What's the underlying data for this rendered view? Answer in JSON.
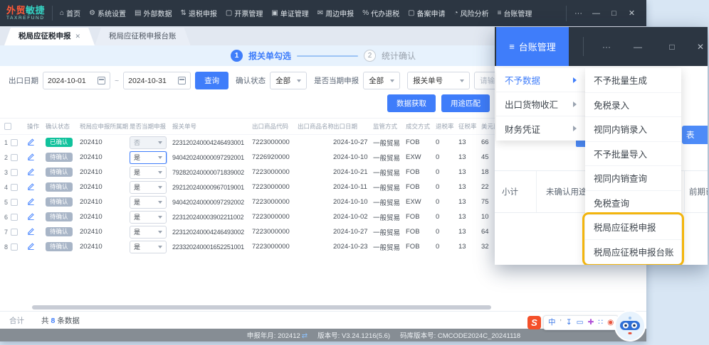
{
  "navbar": {
    "items": [
      {
        "id": "home",
        "glyph": "⌂",
        "icon": "home-icon",
        "label": "首页"
      },
      {
        "id": "system-settings",
        "glyph": "⚙",
        "icon": "gear-icon",
        "label": "系统设置"
      },
      {
        "id": "external-data",
        "glyph": "▤",
        "icon": "list-icon",
        "label": "外部数据"
      },
      {
        "id": "tax-refund-declare",
        "glyph": "⇅",
        "icon": "exchange-icon",
        "label": "退税申报"
      },
      {
        "id": "invoice-mgmt",
        "glyph": "▢",
        "icon": "document-icon",
        "label": "开票管理"
      },
      {
        "id": "document-mgmt",
        "glyph": "▣",
        "icon": "file-icon",
        "label": "单证管理"
      },
      {
        "id": "peripheral-declare",
        "glyph": "✉",
        "icon": "mail-icon",
        "label": "周边申报"
      },
      {
        "id": "agency-refund",
        "glyph": "%",
        "icon": "percent-icon",
        "label": "代办退税"
      },
      {
        "id": "filing-apply",
        "glyph": "▢",
        "icon": "document-icon",
        "label": "备案申请"
      },
      {
        "id": "risk-analysis",
        "glyph": "◔",
        "icon": "clock-icon",
        "label": "风险分析"
      },
      {
        "id": "ledger-mgmt",
        "glyph": "≡",
        "icon": "ledger-icon",
        "label": "台账管理"
      }
    ],
    "logo": {
      "part1": "外贸",
      "part2": "敏捷",
      "subtitle": "TAXREFUND"
    },
    "controls": {
      "more": "···",
      "minimize": "—",
      "maximize": "□",
      "close": "✕"
    }
  },
  "tabs": [
    {
      "label": "税局应征税申报",
      "close": "✕",
      "active": true
    },
    {
      "label": "税局应征税申报台账",
      "active": false
    }
  ],
  "steps": {
    "one_num": "1",
    "one_label": "报关单勾选",
    "two_num": "2",
    "two_label": "统计确认"
  },
  "filters": {
    "export_date_label": "出口日期",
    "date_from": "2024-10-01",
    "date_to": "2024-10-31",
    "range_sep": "~",
    "search_button": "查询",
    "confirm_status_label": "确认状态",
    "confirm_status_value": "全部",
    "current_period_label": "是否当期申报",
    "current_period_value": "全部",
    "doc_type_value": "报关单号",
    "doc_no_placeholder": "请输入报关单号",
    "fetch_button": "数据获取",
    "match_button": "用途匹配"
  },
  "table": {
    "headers": [
      "",
      "操作",
      "确认状态",
      "税局应申报所属期",
      "是否当期申报",
      "报关单号",
      "出口商品代码",
      "出口商品名称",
      "出口日期",
      "监管方式",
      "成交方式",
      "退税率",
      "征税率",
      "美元离岸价"
    ],
    "rows": [
      {
        "no": "1",
        "status": "已确认",
        "status_type": "confirmed",
        "period": "202410",
        "current": "否",
        "select_state": "disabled",
        "decl_no": "223120240004246493001",
        "goods_code": "7223000000",
        "goods_name": "",
        "export_date": "2024-10-27",
        "trade_mode": "一般贸易",
        "terms": "FOB",
        "refund_rate": "0",
        "tax_rate": "13",
        "usd": "66"
      },
      {
        "no": "2",
        "status": "待确认",
        "status_type": "pending",
        "period": "202410",
        "current": "是",
        "select_state": "focused",
        "decl_no": "940420240000097292001",
        "goods_code": "7226920000",
        "goods_name": "",
        "export_date": "2024-10-10",
        "trade_mode": "一般贸易",
        "terms": "EXW",
        "refund_rate": "0",
        "tax_rate": "13",
        "usd": "45"
      },
      {
        "no": "3",
        "status": "待确认",
        "status_type": "pending",
        "period": "202410",
        "current": "是",
        "select_state": "normal",
        "decl_no": "792820240000071839002",
        "goods_code": "7223000000",
        "goods_name": "",
        "export_date": "2024-10-21",
        "trade_mode": "一般贸易",
        "terms": "FOB",
        "refund_rate": "0",
        "tax_rate": "13",
        "usd": "18"
      },
      {
        "no": "4",
        "status": "待确认",
        "status_type": "pending",
        "period": "202410",
        "current": "是",
        "select_state": "normal",
        "decl_no": "292120240000967019001",
        "goods_code": "7223000000",
        "goods_name": "",
        "export_date": "2024-10-11",
        "trade_mode": "一般贸易",
        "terms": "FOB",
        "refund_rate": "0",
        "tax_rate": "13",
        "usd": "22"
      },
      {
        "no": "5",
        "status": "待确认",
        "status_type": "pending",
        "period": "202410",
        "current": "是",
        "select_state": "normal",
        "decl_no": "940420240000097292002",
        "goods_code": "7223000000",
        "goods_name": "",
        "export_date": "2024-10-10",
        "trade_mode": "一般贸易",
        "terms": "EXW",
        "refund_rate": "0",
        "tax_rate": "13",
        "usd": "75"
      },
      {
        "no": "6",
        "status": "待确认",
        "status_type": "pending",
        "period": "202410",
        "current": "是",
        "select_state": "normal",
        "decl_no": "223120240003902211002",
        "goods_code": "7223000000",
        "goods_name": "",
        "export_date": "2024-10-02",
        "trade_mode": "一般贸易",
        "terms": "FOB",
        "refund_rate": "0",
        "tax_rate": "13",
        "usd": "10"
      },
      {
        "no": "7",
        "status": "待确认",
        "status_type": "pending",
        "period": "202410",
        "current": "是",
        "select_state": "normal",
        "decl_no": "223120240004246493002",
        "goods_code": "7223000000",
        "goods_name": "",
        "export_date": "2024-10-27",
        "trade_mode": "一般贸易",
        "terms": "FOB",
        "refund_rate": "0",
        "tax_rate": "13",
        "usd": "64"
      },
      {
        "no": "8",
        "status": "待确认",
        "status_type": "pending",
        "period": "202410",
        "current": "是",
        "select_state": "normal",
        "decl_no": "223320240001652251001",
        "goods_code": "7223000000",
        "goods_name": "",
        "export_date": "2024-10-23",
        "trade_mode": "一般贸易",
        "terms": "FOB",
        "refund_rate": "0",
        "tax_rate": "13",
        "usd": "32"
      }
    ]
  },
  "footer": {
    "total_label": "合计",
    "count_prefix": "共",
    "count": "8",
    "count_suffix": "条数据"
  },
  "statusbar": {
    "period_label": "申报年月:",
    "period_value": "202412",
    "swap_icon": "⇄",
    "version_label": "版本号:",
    "version_value": "V3.24.1216(5.6)",
    "codebase_label": "码库版本号:",
    "codebase_value": "CMCODE2024C_20241118"
  },
  "ime": {
    "logo": "S",
    "icons": [
      {
        "name": "ime-lang-icon",
        "glyph": "中",
        "color": "#3b78e7"
      },
      {
        "name": "ime-punctuation-icon",
        "glyph": "’",
        "color": "#8a94a0"
      },
      {
        "name": "ime-mic-icon",
        "glyph": "↧",
        "color": "#3b78e7"
      },
      {
        "name": "ime-keyboard-icon",
        "glyph": "▭",
        "color": "#3b78e7"
      },
      {
        "name": "ime-toolbox-icon",
        "glyph": "✚",
        "color": "#b052d8"
      },
      {
        "name": "ime-grid-icon",
        "glyph": "∷",
        "color": "#3b78e7"
      },
      {
        "name": "ime-emoji-icon",
        "glyph": "◉",
        "color": "#e8553e"
      }
    ]
  },
  "overlay": {
    "title": "台账管理",
    "title_icon": "≡",
    "controls": {
      "more": "···",
      "minimize": "—",
      "maximize": "□",
      "close": "✕"
    },
    "menu": [
      {
        "label": "不予数据",
        "active": true
      },
      {
        "label": "出口货物收汇",
        "active": false
      },
      {
        "label": "财务凭证",
        "active": false
      }
    ],
    "submenu": [
      "不予批量生成",
      "免税录入",
      "视同内销录入",
      "不予批量导入",
      "视同内销查询",
      "免税查询",
      "税局应征税申报",
      "税局应征税申报台账"
    ],
    "highlight_start_index": 6,
    "content": {
      "partial_button_label": "表",
      "subtotal_label": "小计",
      "unconfirmed_label": "未确认用途",
      "prior_label": "前期已"
    }
  },
  "colors": {
    "accent": "#3f7dfa",
    "navbar": "#2c3642",
    "badge_confirmed": "#10c29c",
    "badge_pending": "#a8b5c7",
    "highlight": "#f3b50d",
    "statusbar": "#868d94",
    "desktop": "#d8e6f4",
    "logo_orange": "#ff5a38",
    "logo_teal": "#35d3c3",
    "sogou": "#f4502a"
  }
}
